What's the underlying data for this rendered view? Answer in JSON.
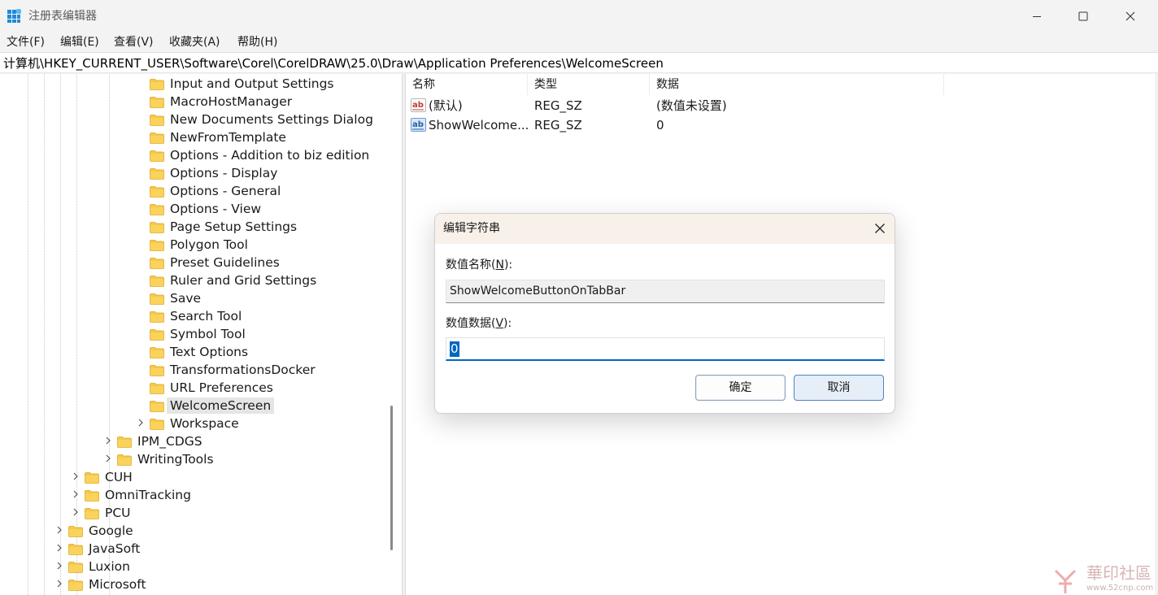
{
  "window": {
    "title": "注册表编辑器"
  },
  "menu": [
    {
      "id": "file",
      "label": "文件(F)"
    },
    {
      "id": "edit",
      "label": "编辑(E)"
    },
    {
      "id": "view",
      "label": "查看(V)"
    },
    {
      "id": "favorites",
      "label": "收藏夹(A)"
    },
    {
      "id": "help",
      "label": "帮助(H)"
    }
  ],
  "address": "计算机\\HKEY_CURRENT_USER\\Software\\Corel\\CorelDRAW\\25.0\\Draw\\Application Preferences\\WelcomeScreen",
  "tree": [
    {
      "label": "Input and Output Settings",
      "level": 5,
      "chevron": false
    },
    {
      "label": "MacroHostManager",
      "level": 5,
      "chevron": false
    },
    {
      "label": "New Documents Settings Dialog",
      "level": 5,
      "chevron": false
    },
    {
      "label": "NewFromTemplate",
      "level": 5,
      "chevron": false
    },
    {
      "label": "Options - Addition to biz edition",
      "level": 5,
      "chevron": false
    },
    {
      "label": "Options - Display",
      "level": 5,
      "chevron": false
    },
    {
      "label": "Options - General",
      "level": 5,
      "chevron": false
    },
    {
      "label": "Options - View",
      "level": 5,
      "chevron": false
    },
    {
      "label": "Page Setup Settings",
      "level": 5,
      "chevron": false
    },
    {
      "label": "Polygon Tool",
      "level": 5,
      "chevron": false
    },
    {
      "label": "Preset Guidelines",
      "level": 5,
      "chevron": false
    },
    {
      "label": "Ruler and Grid Settings",
      "level": 5,
      "chevron": false
    },
    {
      "label": "Save",
      "level": 5,
      "chevron": false
    },
    {
      "label": "Search Tool",
      "level": 5,
      "chevron": false
    },
    {
      "label": "Symbol Tool",
      "level": 5,
      "chevron": false
    },
    {
      "label": "Text Options",
      "level": 5,
      "chevron": false
    },
    {
      "label": "TransformationsDocker",
      "level": 5,
      "chevron": false
    },
    {
      "label": "URL Preferences",
      "level": 5,
      "chevron": false
    },
    {
      "label": "WelcomeScreen",
      "level": 5,
      "chevron": false,
      "selected": true
    },
    {
      "label": "Workspace",
      "level": 5,
      "chevron": true
    },
    {
      "label": "IPM_CDGS",
      "level": 4,
      "chevron": true
    },
    {
      "label": "WritingTools",
      "level": 4,
      "chevron": true
    },
    {
      "label": "CUH",
      "level": 3,
      "chevron": true
    },
    {
      "label": "OmniTracking",
      "level": 3,
      "chevron": true
    },
    {
      "label": "PCU",
      "level": 3,
      "chevron": true
    },
    {
      "label": "Google",
      "level": 2,
      "chevron": true
    },
    {
      "label": "JavaSoft",
      "level": 2,
      "chevron": true
    },
    {
      "label": "Luxion",
      "level": 2,
      "chevron": true
    },
    {
      "label": "Microsoft",
      "level": 2,
      "chevron": true
    }
  ],
  "list": {
    "columns": [
      "名称",
      "类型",
      "数据"
    ],
    "rows": [
      {
        "name": "(默认)",
        "type": "REG_SZ",
        "data": "(数值未设置)"
      },
      {
        "name": "ShowWelcome...",
        "type": "REG_SZ",
        "data": "0"
      }
    ]
  },
  "dialog": {
    "title": "编辑字符串",
    "name_label_prefix": "数值名称(",
    "name_label_key": "N",
    "name_label_suffix": "):",
    "name_value": "ShowWelcomeButtonOnTabBar",
    "data_label_prefix": "数值数据(",
    "data_label_key": "V",
    "data_label_suffix": "):",
    "data_value": "0",
    "ok_label": "确定",
    "cancel_label": "取消"
  },
  "watermark": {
    "text": "華印社區",
    "url": "www.52cnp.com"
  },
  "colors": {
    "accent": "#0067c0",
    "folder": "#f7c948",
    "selection": "#e5e5e5",
    "dialog_title_bg": "#f7f1ea"
  }
}
